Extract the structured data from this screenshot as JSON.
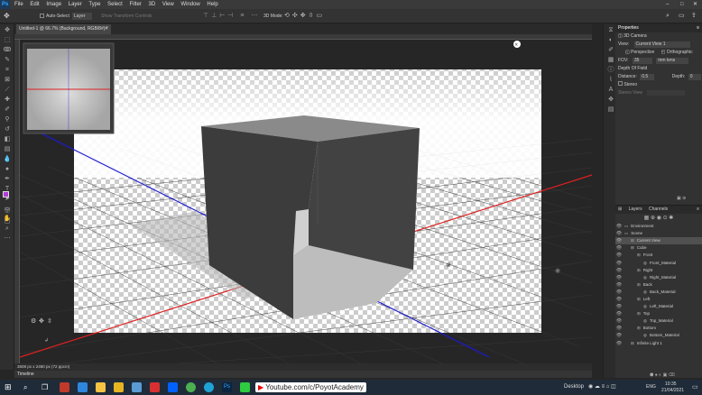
{
  "menu": [
    "File",
    "Edit",
    "Image",
    "Layer",
    "Type",
    "Select",
    "Filter",
    "3D",
    "View",
    "Window",
    "Help"
  ],
  "options_bar": {
    "auto_select_label": "Auto-Select",
    "layer_dropdown": "Layer",
    "transform_label": "Show Transform Controls",
    "mode_3d": "3D Mode:"
  },
  "document": {
    "tab_title": "Untitled-1 @ 66.7% (Background, RGB/8#) *",
    "status": "3508 px x 2480 px (72 ppcm)"
  },
  "timeline_label": "Timeline",
  "properties": {
    "title": "Properties",
    "section": "3D Camera",
    "view_label": "View:",
    "view_value": "Current View 1",
    "perspective": "Perspective",
    "orthographic": "Orthographic",
    "fov_label": "FOV:",
    "fov_value": "35",
    "fov_unit": "mm lens",
    "dof_label": "Depth Of Field",
    "distance_label": "Distance:",
    "distance_value": "0.5",
    "depth_label": "Depth:",
    "depth_value": "0",
    "stereo_label": "Stereo",
    "stereo_view_label": "Stereo View"
  },
  "layers_panel": {
    "tabs": [
      "Layers",
      "Channels"
    ],
    "items": [
      {
        "name": "Environment",
        "indent": 0
      },
      {
        "name": "Scene",
        "indent": 0
      },
      {
        "name": "Current View",
        "indent": 1,
        "selected": true
      },
      {
        "name": "Cube",
        "indent": 1
      },
      {
        "name": "Front",
        "indent": 2
      },
      {
        "name": "Front_Material",
        "indent": 3
      },
      {
        "name": "Right",
        "indent": 2
      },
      {
        "name": "Right_Material",
        "indent": 3
      },
      {
        "name": "Back",
        "indent": 2
      },
      {
        "name": "Back_Material",
        "indent": 3
      },
      {
        "name": "Left",
        "indent": 2
      },
      {
        "name": "Left_Material",
        "indent": 3
      },
      {
        "name": "Top",
        "indent": 2
      },
      {
        "name": "Top_Material",
        "indent": 3
      },
      {
        "name": "Bottom",
        "indent": 2
      },
      {
        "name": "Bottom_Material",
        "indent": 3
      },
      {
        "name": "Infinite Light 1",
        "indent": 1
      }
    ]
  },
  "taskbar": {
    "url_text": "Youtube.com/c/PoyotAcademy",
    "desktop_label": "Desktop",
    "lang": "ENG",
    "time": "10:35",
    "date": "21/04/2021"
  }
}
